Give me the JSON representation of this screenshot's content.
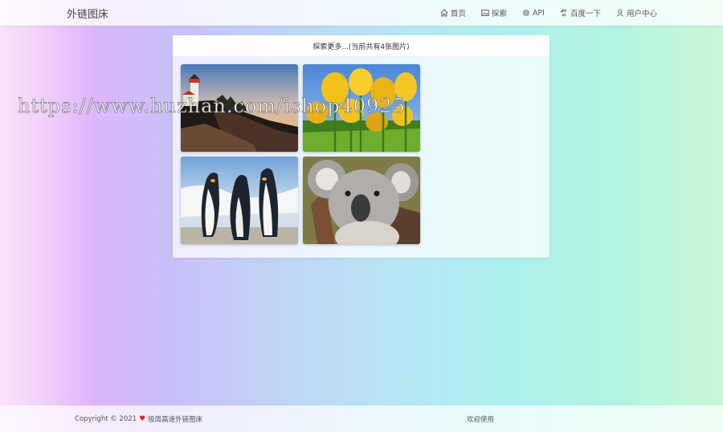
{
  "header": {
    "brand": "外链图床",
    "nav": [
      {
        "icon": "home-icon",
        "label": "首页"
      },
      {
        "icon": "image-icon",
        "label": "探索"
      },
      {
        "icon": "gear-icon",
        "label": "API"
      },
      {
        "icon": "paw-icon",
        "label": "百度一下"
      },
      {
        "icon": "user-icon",
        "label": "用户中心"
      }
    ]
  },
  "gallery": {
    "title": "探索更多...(当前共有4张图片)",
    "images": [
      {
        "subject": "lighthouse"
      },
      {
        "subject": "tulips"
      },
      {
        "subject": "penguins"
      },
      {
        "subject": "koala"
      }
    ]
  },
  "watermark": "https://www.huzhan.com/ishop40925",
  "footer": {
    "copyright": "Copyright © 2021",
    "heart_icon": "heart-icon",
    "site_name": "极简高速外链图床",
    "welcome": "欢迎使用"
  },
  "colors": {
    "heart": "#e02020"
  }
}
